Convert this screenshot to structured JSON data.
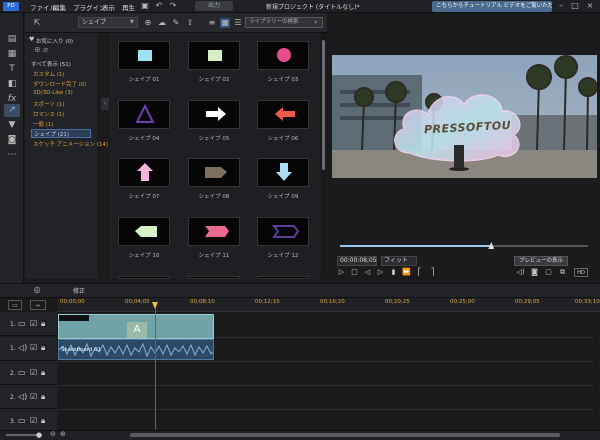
{
  "app": {
    "title": "新規プロジェクト (タイトルなし)*",
    "logo": "PD"
  },
  "menu": [
    "ファイル",
    "編集",
    "プラグイン",
    "表示",
    "再生"
  ],
  "output_label": "出力",
  "notice": "こちらからチュートリアル ビデオをご覧いただけます。",
  "library": {
    "dropdown": "シェイプ",
    "search_placeholder": "ライブラリーの検索",
    "categories": [
      "お気に入り (0)",
      "すべて表示 (51)",
      "カスタム (1)",
      "ダウンロード完了 (0)",
      "3D/3D-Like (3)",
      "スポーツ (1)",
      "ロマンス (1)",
      "一般 (1)",
      "シェイプ (21)",
      "スケッチ アニメーション (14)"
    ]
  },
  "thumbnails": [
    {
      "label": "シェイプ 01",
      "kind": "square",
      "color": "#9fe3f2"
    },
    {
      "label": "シェイプ 02",
      "kind": "square",
      "color": "#d6efc4"
    },
    {
      "label": "シェイプ 03",
      "kind": "circle",
      "color": "#e94c8a"
    },
    {
      "label": "シェイプ 04",
      "kind": "triangle",
      "color": "#6d3fb1"
    },
    {
      "label": "シェイプ 05",
      "kind": "arrow-right",
      "color": "#ffffff"
    },
    {
      "label": "シェイプ 06",
      "kind": "arrow-left",
      "color": "#ef5c4c"
    },
    {
      "label": "シェイプ 07",
      "kind": "arrow-up",
      "color": "#f4b6dc"
    },
    {
      "label": "シェイプ 08",
      "kind": "pentagon",
      "color": "#7e6e5e"
    },
    {
      "label": "シェイプ 09",
      "kind": "arrow-down",
      "color": "#a9dcf5"
    },
    {
      "label": "シェイプ 10",
      "kind": "tag-left",
      "color": "#d8f0c8"
    },
    {
      "label": "シェイプ 11",
      "kind": "banner",
      "color": "#e96a8e"
    },
    {
      "label": "シェイプ 12",
      "kind": "banner-dark",
      "color": "#5e3c9c"
    }
  ],
  "preview": {
    "overlay_text": "PRESSOFTOU",
    "timecode": "00:00:08;05",
    "fit": "フィット",
    "preview_window": "プレビューの表示",
    "progress": 0.61
  },
  "timeline": {
    "fix_label": "修正",
    "ruler_ticks": [
      "00;00;00",
      "00;04;05",
      "00;08;10",
      "00;12;15",
      "00;16;20",
      "00;20;25",
      "00;25;00",
      "00;29;05",
      "00;33;10"
    ],
    "tracks": [
      "1.",
      "1.",
      "2.",
      "2.",
      "3."
    ],
    "video_clip_letter": "A",
    "audio_clip_label": "Skateboard 01"
  }
}
